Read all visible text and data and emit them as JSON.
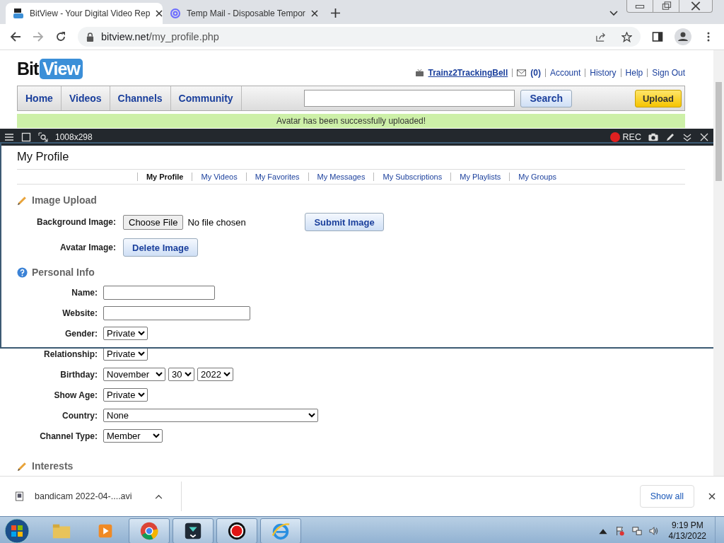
{
  "browser": {
    "tabs": [
      {
        "title": "BitView - Your Digital Video Rep",
        "selected": true,
        "kind": "bitview"
      },
      {
        "title": "Temp Mail - Disposable Tempor",
        "selected": false,
        "kind": "mail"
      }
    ],
    "url_host": "bitview.net",
    "url_path": "/my_profile.php"
  },
  "site": {
    "logo_left": "Bit",
    "logo_right": "View",
    "user": "Trainz2TrackingBell",
    "inbox_count": "(0)",
    "user_links": [
      "Account",
      "History",
      "Help",
      "Sign Out"
    ],
    "nav": [
      "Home",
      "Videos",
      "Channels",
      "Community"
    ],
    "search_button": "Search",
    "upload_button": "Upload",
    "banner": "Avatar has been successfully uploaded!"
  },
  "recorder": {
    "size": "1008x298",
    "rec_label": "REC"
  },
  "profile": {
    "title": "My Profile",
    "tabs": [
      {
        "label": "My Profile",
        "selected": true
      },
      {
        "label": "My Videos",
        "selected": false
      },
      {
        "label": "My Favorites",
        "selected": false
      },
      {
        "label": "My Messages",
        "selected": false
      },
      {
        "label": "My Subscriptions",
        "selected": false
      },
      {
        "label": "My Playlists",
        "selected": false
      },
      {
        "label": "My Groups",
        "selected": false
      }
    ],
    "image_upload": {
      "heading": "Image Upload",
      "background_label": "Background Image:",
      "choose_file": "Choose File",
      "no_file": "No file chosen",
      "submit": "Submit Image",
      "avatar_label": "Avatar Image:",
      "delete": "Delete Image"
    },
    "personal_info": {
      "heading": "Personal Info",
      "fields": [
        {
          "label": "Name:",
          "kind": "text"
        },
        {
          "label": "Website:",
          "kind": "text"
        },
        {
          "label": "Gender:",
          "kind": "select",
          "values": [
            "Private"
          ]
        },
        {
          "label": "Relationship:",
          "kind": "select",
          "values": [
            "Private"
          ]
        },
        {
          "label": "Birthday:",
          "kind": "select",
          "values": [
            "November",
            "30",
            "2022"
          ]
        },
        {
          "label": "Show Age:",
          "kind": "select",
          "values": [
            "Private"
          ]
        },
        {
          "label": "Country:",
          "kind": "select",
          "values": [
            "None"
          ]
        },
        {
          "label": "Channel Type:",
          "kind": "select",
          "values": [
            "Member"
          ]
        }
      ]
    },
    "next_heading": "Interests"
  },
  "download_bar": {
    "file": "bandicam 2022-04-....avi",
    "show_all": "Show all"
  },
  "taskbar": {
    "time": "9:19 PM",
    "date": "4/13/2022"
  }
}
